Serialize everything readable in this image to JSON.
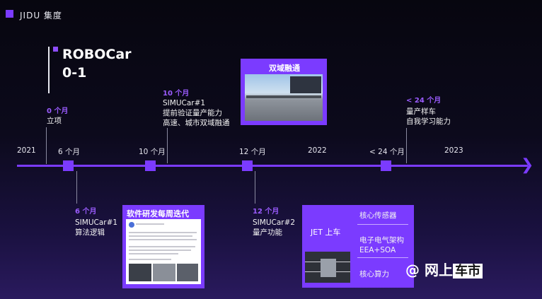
{
  "brand": {
    "name": "JIDU 集度"
  },
  "robocar": {
    "title_line1": "ROBOCar",
    "title_line2": "0-1"
  },
  "timeline": {
    "years": {
      "y2021": "2021",
      "y2022": "2022",
      "y2023": "2023"
    },
    "months": {
      "m6": "6 个月",
      "m10": "10 个月",
      "m12": "12 个月",
      "m24": "< 24 个月"
    }
  },
  "milestones": {
    "m0": {
      "label": "0 个月",
      "text": "立项"
    },
    "m10": {
      "label": "10 个月",
      "line1": "SIMUCar#1",
      "line2": "提前验证量产能力",
      "line3": "高速、城市双域融通"
    },
    "m24": {
      "label": "< 24 个月",
      "line1": "量产样车",
      "line2": "自我学习能力"
    },
    "m6": {
      "label": "6 个月",
      "line1": "SIMUCar#1",
      "line2": "算法逻辑"
    },
    "m12": {
      "label": "12 个月",
      "line1": "SIMUCar#2",
      "line2": "量产功能"
    }
  },
  "cards": {
    "dual_domain": {
      "title": "双域融通"
    },
    "software": {
      "title": "软件研发每周迭代"
    },
    "jet": {
      "title": "JET 上车",
      "items": [
        "核心传感器",
        "电子电气架构",
        "EEA+SOA",
        "核心算力"
      ]
    }
  },
  "watermark": {
    "at": "@",
    "text1": "网上",
    "text2": "车市"
  },
  "colors": {
    "accent": "#7b3bff",
    "accent_text": "#9b5cff",
    "background_top": "#07060f",
    "background_bottom": "#2a1a5e"
  }
}
